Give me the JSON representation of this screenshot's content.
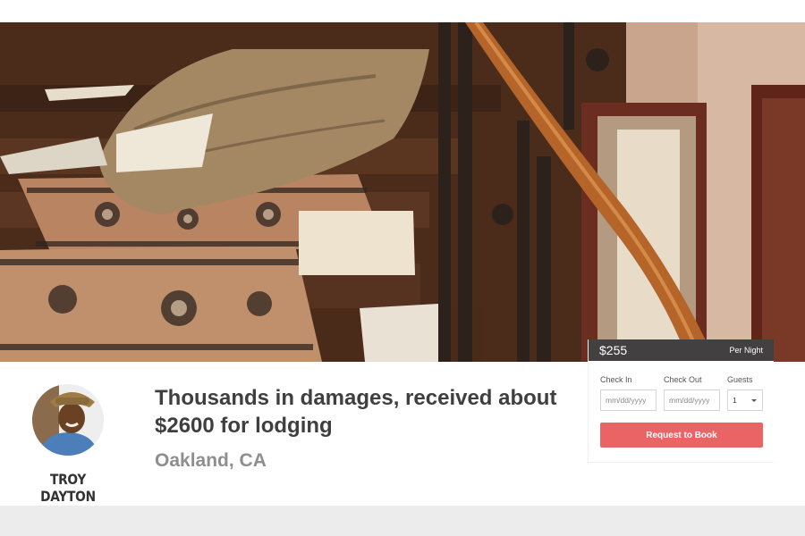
{
  "listing": {
    "title": "Thousands in damages, received about $2600 for lodging",
    "location": "Oakland, CA"
  },
  "host": {
    "name": "TROY DAYTON"
  },
  "booking": {
    "price": "$255",
    "price_unit": "Per Night",
    "check_in_label": "Check In",
    "check_out_label": "Check Out",
    "guests_label": "Guests",
    "check_in_placeholder": "mm/dd/yyyy",
    "check_out_placeholder": "mm/dd/yyyy",
    "guests_value": "1",
    "button_label": "Request to Book",
    "button_color": "#ea6466"
  }
}
